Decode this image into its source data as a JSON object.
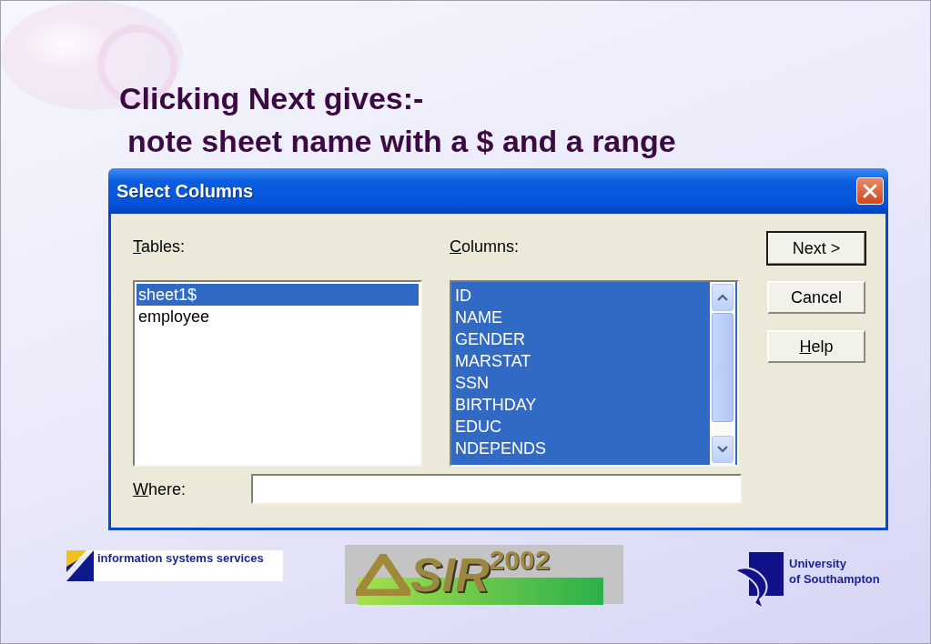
{
  "slide": {
    "title_lines": [
      "Clicking Next gives:-",
      "note sheet name with a $ and a range"
    ]
  },
  "dialog": {
    "title": "Select Columns",
    "tables_label": {
      "key": "T",
      "rest": "ables:"
    },
    "columns_label": {
      "key": "C",
      "rest": "olumns:"
    },
    "tables": [
      {
        "name": "sheet1$",
        "selected": true
      },
      {
        "name": "employee",
        "selected": false
      }
    ],
    "columns": [
      {
        "name": "ID",
        "selected": true
      },
      {
        "name": "NAME",
        "selected": true
      },
      {
        "name": "GENDER",
        "selected": true
      },
      {
        "name": "MARSTAT",
        "selected": true
      },
      {
        "name": "SSN",
        "selected": true
      },
      {
        "name": "BIRTHDAY",
        "selected": true
      },
      {
        "name": "EDUC",
        "selected": true
      },
      {
        "name": "NDEPENDS",
        "selected": true
      }
    ],
    "where_label": {
      "key": "W",
      "rest": "here:"
    },
    "buttons": [
      {
        "rest": "Next >",
        "default": true
      },
      {
        "rest": "Cancel",
        "default": false
      },
      {
        "key": "H",
        "rest": "elp",
        "default": false
      }
    ]
  },
  "footer": {
    "iss_logo": "information systems services",
    "asir_logo": {
      "word": "SIR",
      "year": "2002"
    },
    "university_logo": [
      "University",
      "of Southampton"
    ]
  }
}
